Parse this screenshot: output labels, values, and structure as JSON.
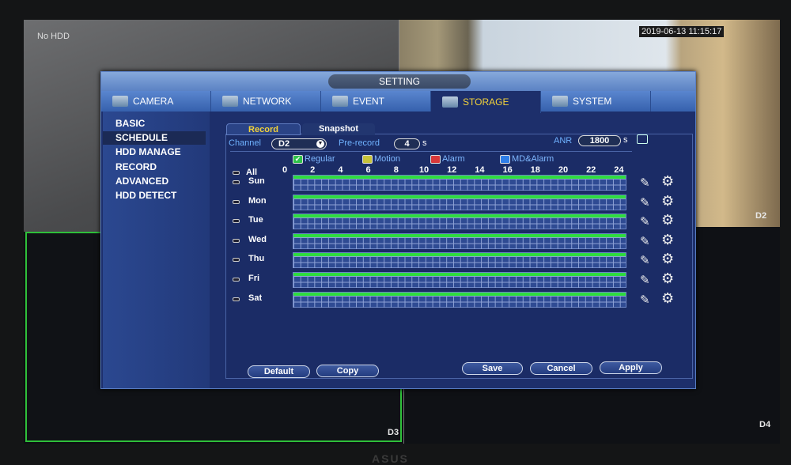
{
  "screen": {
    "no_hdd": "No HDD",
    "timestamp": "2019-06-13 11:15:17",
    "channels": [
      "D2",
      "D3",
      "D4"
    ]
  },
  "dialog": {
    "title": "SETTING",
    "tabs": [
      {
        "label": "CAMERA",
        "icon": "camera-icon"
      },
      {
        "label": "NETWORK",
        "icon": "network-icon"
      },
      {
        "label": "EVENT",
        "icon": "event-icon"
      },
      {
        "label": "STORAGE",
        "icon": "storage-icon",
        "active": true
      },
      {
        "label": "SYSTEM",
        "icon": "system-icon"
      }
    ],
    "sidebar": [
      "BASIC",
      "SCHEDULE",
      "HDD MANAGE",
      "RECORD",
      "ADVANCED",
      "HDD DETECT"
    ],
    "selected_sidebar": "SCHEDULE",
    "subtabs": [
      "Record",
      "Snapshot"
    ],
    "channel_label": "Channel",
    "channel_value": "D2",
    "prerecord_label": "Pre-record",
    "prerecord_value": "4",
    "prerecord_unit": "s",
    "anr_label": "ANR",
    "anr_value": "1800",
    "anr_unit": "s",
    "anr_checked": false,
    "legend": [
      {
        "label": "Regular",
        "color": "#2fc34a",
        "checked": true
      },
      {
        "label": "Motion",
        "color": "#c8c43a"
      },
      {
        "label": "Alarm",
        "color": "#d8383a"
      },
      {
        "label": "MD&Alarm",
        "color": "#2f7fe8"
      }
    ],
    "all_label": "All",
    "hours": [
      "0",
      "2",
      "4",
      "6",
      "8",
      "10",
      "12",
      "14",
      "16",
      "18",
      "20",
      "22",
      "24"
    ],
    "days": [
      {
        "name": "Sun",
        "regular": [
          0,
          24
        ]
      },
      {
        "name": "Mon",
        "regular": [
          0,
          24
        ]
      },
      {
        "name": "Tue",
        "regular": [
          0,
          24
        ]
      },
      {
        "name": "Wed",
        "regular": [
          0,
          24
        ]
      },
      {
        "name": "Thu",
        "regular": [
          0,
          24
        ]
      },
      {
        "name": "Fri",
        "regular": [
          0,
          24
        ]
      },
      {
        "name": "Sat",
        "regular": [
          0,
          24
        ]
      }
    ],
    "buttons": {
      "default": "Default",
      "copy": "Copy",
      "save": "Save",
      "cancel": "Cancel",
      "apply": "Apply"
    }
  },
  "monitor_brand": "ASUS"
}
